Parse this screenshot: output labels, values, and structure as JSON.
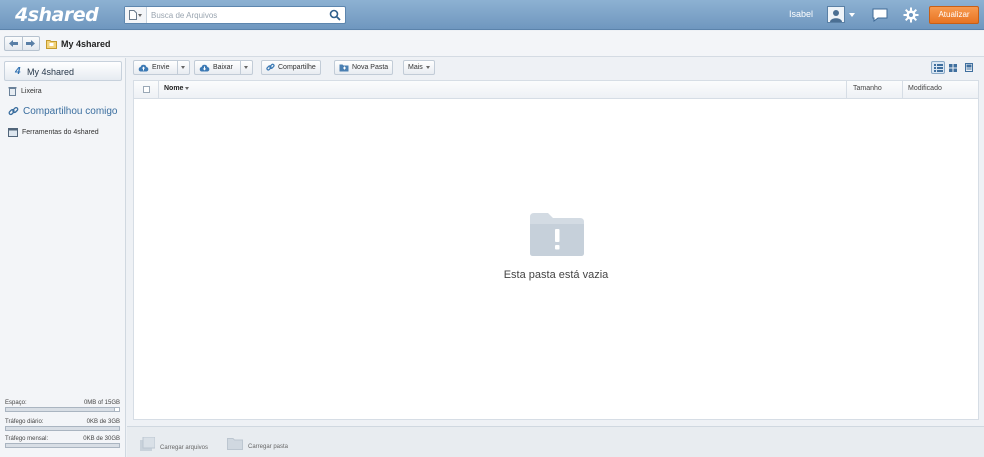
{
  "header": {
    "logo_text": "4shared",
    "search_placeholder": "Busca de Arquivos",
    "username": "Isabel",
    "upgrade_label": "Atualizar"
  },
  "breadcrumb": {
    "title": "My 4shared"
  },
  "sidebar": {
    "main_label": "My 4shared",
    "items": [
      {
        "label": "Lixeira",
        "icon": "trash-icon"
      },
      {
        "label": "Compartilhou comigo",
        "icon": "link-icon"
      },
      {
        "label": "Ferramentas do 4shared",
        "icon": "tools-icon"
      }
    ],
    "stats": [
      {
        "label": "Espaço:",
        "value": "0MB of 15GB",
        "fraction": 0.0
      },
      {
        "label": "Tráfego diário:",
        "value": "0KB de 3GB",
        "fraction": 0.0
      },
      {
        "label": "Tráfego mensal:",
        "value": "0KB de 30GB",
        "fraction": 0.0
      }
    ]
  },
  "toolbar": {
    "upload_label": "Envie",
    "download_label": "Baixar",
    "share_label": "Compartilhe",
    "new_folder_label": "Nova Pasta",
    "more_label": "Mais",
    "active_view": "list"
  },
  "table": {
    "columns": [
      "Nome",
      "Tamanho",
      "Modificado"
    ]
  },
  "empty_message": "Esta pasta está vazia",
  "footer": {
    "upload_files_label": "Carregar arquivos",
    "upload_folder_label": "Carregar pasta"
  },
  "colors": {
    "header_blue": "#7aa0c7",
    "upgrade_orange": "#ef8430",
    "link_blue": "#3a6e9f"
  }
}
